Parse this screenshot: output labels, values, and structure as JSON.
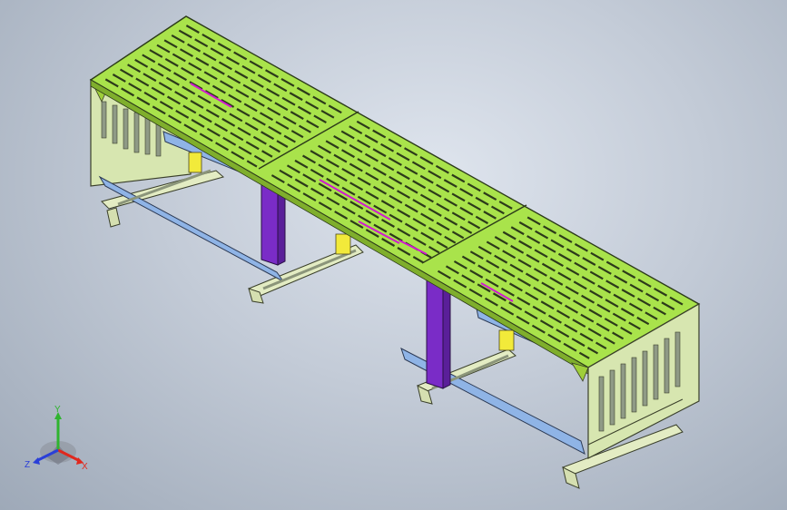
{
  "window": {
    "title": ""
  },
  "viewport": {
    "background_color": "#b7c0cd"
  },
  "model": {
    "name": "",
    "components": {
      "grating_color": "#a9e34b",
      "end_frame_color": "#d7e6b0",
      "purple_post_color": "#7a2cc7",
      "blue_beam_color": "#8fb4e6",
      "yellow_bracket_color": "#f2ea3a",
      "foot_channel_color": "#e3ecc3",
      "highlight_color": "#d01ad0"
    }
  },
  "triad": {
    "x_label": "X",
    "y_label": "Y",
    "z_label": "Z",
    "x_color": "#e0281d",
    "y_color": "#2fb42f",
    "z_color": "#2a3fd8"
  }
}
